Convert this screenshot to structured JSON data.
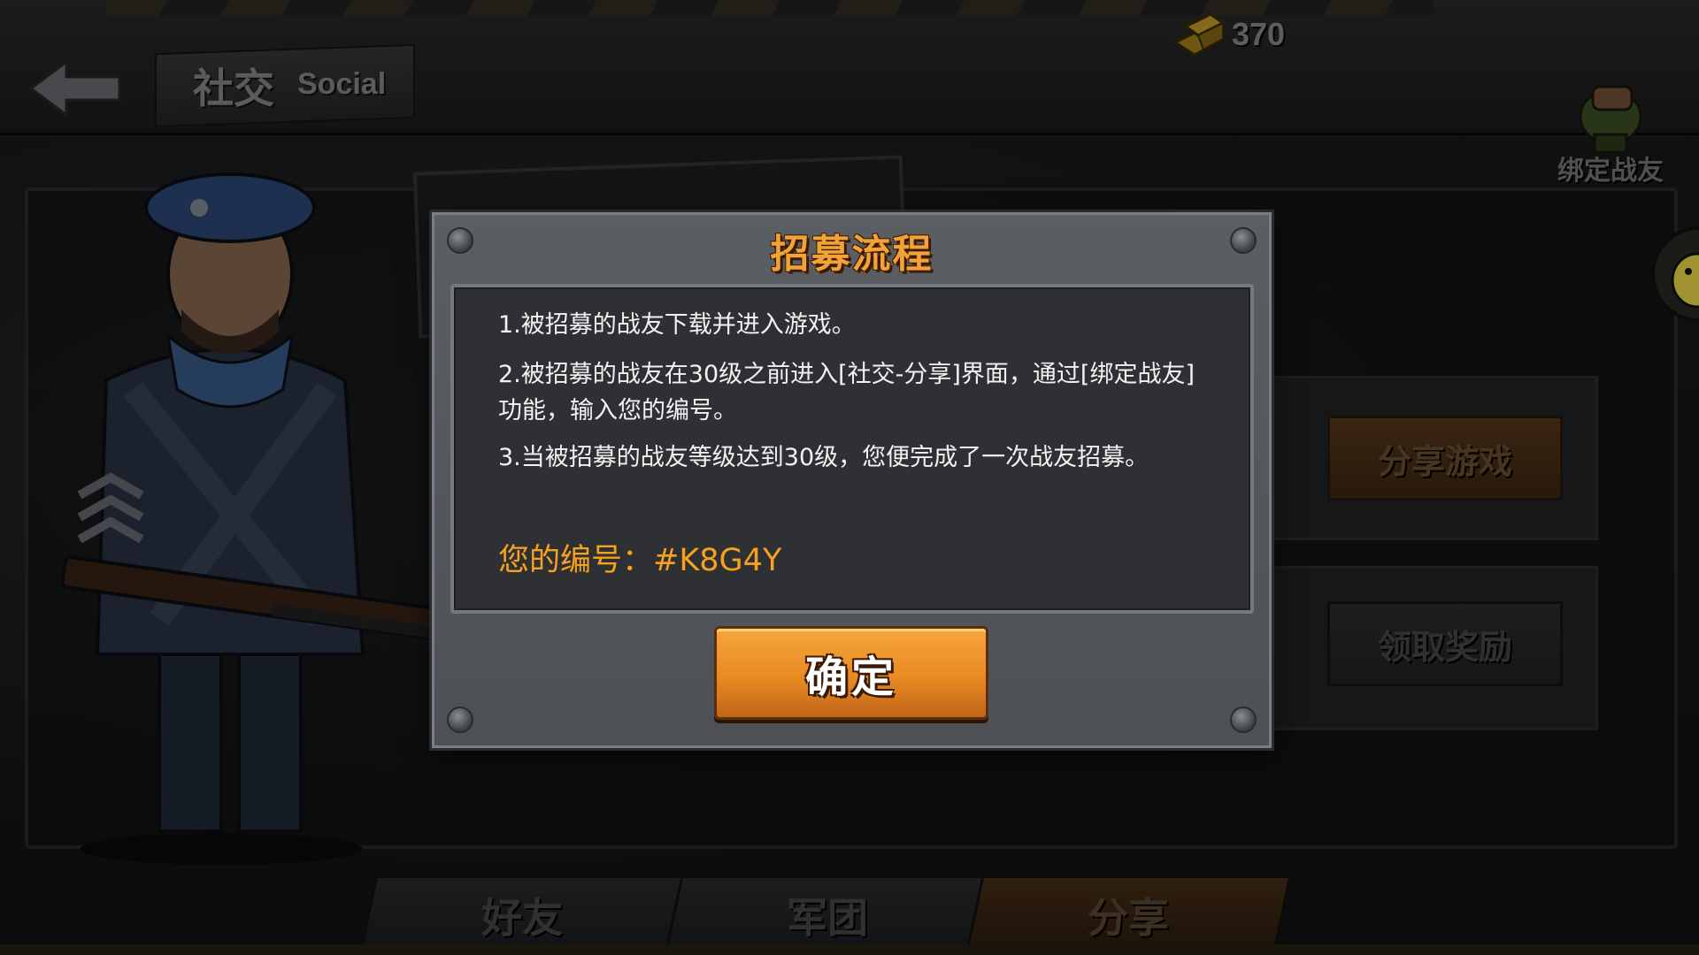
{
  "header": {
    "title_cn": "社交",
    "title_en": "Social",
    "gold_amount": "370",
    "bind_label": "绑定战友"
  },
  "side_panel": {
    "share_game_label": "分享游戏",
    "claim_reward_label": "领取奖励"
  },
  "tabs": [
    {
      "label": "好友",
      "active": false
    },
    {
      "label": "军团",
      "active": false
    },
    {
      "label": "分享",
      "active": true
    }
  ],
  "dialog": {
    "title": "招募流程",
    "steps": [
      "1.被招募的战友下载并进入游戏。",
      "2.被招募的战友在30级之前进入[社交-分享]界面，通过[绑定战友]功能，输入您的编号。",
      "3.当被招募的战友等级达到30级，您便完成了一次战友招募。"
    ],
    "code_label": "您的编号：",
    "code_value": "#K8G4Y",
    "confirm_label": "确定"
  },
  "colors": {
    "accent_orange": "#f6a21c",
    "title_orange": "#f3a235",
    "dialog_bg": "#5b5e63",
    "body_bg": "#2e3033"
  },
  "icons": [
    "back-arrow-icon",
    "gold-bar-icon",
    "bind-friend-fist-icon",
    "chick-icon",
    "rivet-icon"
  ]
}
